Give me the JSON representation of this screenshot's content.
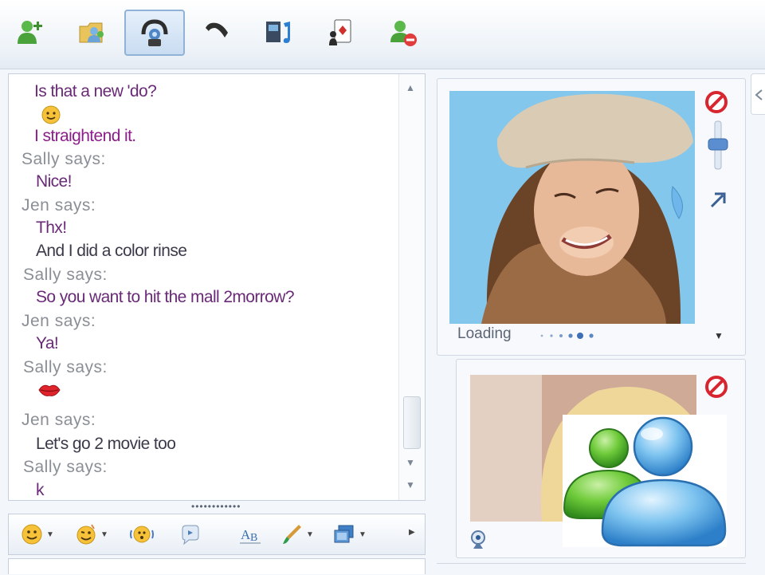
{
  "toolbar": {
    "buttons": [
      {
        "icon": "invite-contact-icon"
      },
      {
        "icon": "share-files-icon"
      },
      {
        "icon": "video-call-icon",
        "active": true
      },
      {
        "icon": "phone-call-icon"
      },
      {
        "icon": "activities-icon"
      },
      {
        "icon": "games-icon"
      },
      {
        "icon": "block-contact-icon"
      }
    ]
  },
  "conversation": {
    "lines": [
      {
        "kind": "message",
        "text": "Is that a new 'do?"
      },
      {
        "kind": "emoticon",
        "icon": "smile-emoticon-icon"
      },
      {
        "kind": "message",
        "text": "I straightend it."
      },
      {
        "kind": "speaker",
        "text": "Sally says:"
      },
      {
        "kind": "message",
        "text": "Nice!"
      },
      {
        "kind": "speaker",
        "text": "Jen says:"
      },
      {
        "kind": "message",
        "text": "Thx!"
      },
      {
        "kind": "message",
        "text": "And I did a color rinse"
      },
      {
        "kind": "speaker",
        "text": "Sally says:"
      },
      {
        "kind": "message",
        "text": "So you want to hit the mall 2morrow?"
      },
      {
        "kind": "speaker",
        "text": "Jen says:"
      },
      {
        "kind": "message",
        "text": "Ya!"
      },
      {
        "kind": "speaker",
        "text": "Sally says:"
      },
      {
        "kind": "emoticon",
        "icon": "kiss-lips-emoticon-icon"
      },
      {
        "kind": "speaker",
        "text": "Jen says:"
      },
      {
        "kind": "message",
        "text": "Let's go 2 movie too"
      },
      {
        "kind": "speaker",
        "text": "Sally says:"
      },
      {
        "kind": "message",
        "text": "k"
      }
    ]
  },
  "splitter": {
    "grip": "••••••••••••"
  },
  "format_bar": {
    "buttons": [
      {
        "icon": "emoticons-icon",
        "dropdown": true
      },
      {
        "icon": "winks-icon",
        "dropdown": true
      },
      {
        "icon": "nudge-icon",
        "dropdown": false
      },
      {
        "icon": "voice-clip-icon",
        "dropdown": false
      },
      {
        "icon": "font-icon",
        "dropdown": false
      },
      {
        "icon": "background-icon",
        "dropdown": true
      },
      {
        "icon": "display-picture-icon",
        "dropdown": true
      }
    ],
    "overflow_icon": "more-arrow-icon"
  },
  "contact_panel": {
    "status": "Loading",
    "photo": "contact-photo",
    "side_icons": [
      "block-icon",
      "volume-slider-icon",
      "expand-icon"
    ]
  },
  "self_panel": {
    "photo": "self-photo",
    "side_icons": [
      "block-icon"
    ],
    "bottom_icon": "webcam-icon"
  },
  "logo": {
    "name": "messenger-buddies-logo"
  },
  "colors": {
    "message_text": "#6a2a78",
    "speaker_text": "#8a8f96",
    "frame_border": "#c5cfdc",
    "photo_sky": "#7fc4ea"
  }
}
